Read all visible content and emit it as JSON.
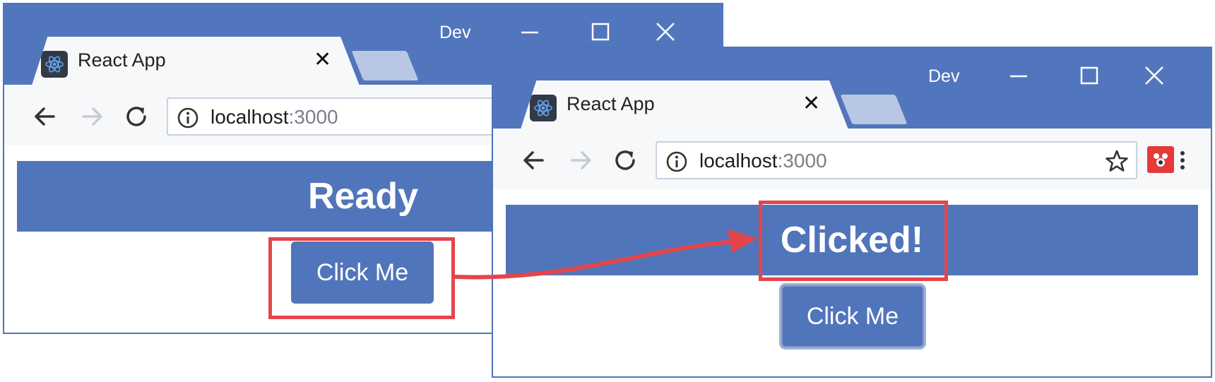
{
  "colors": {
    "chrome_blue": "#5276bd",
    "banner_blue": "#5175bb",
    "highlight_red": "#e3454b"
  },
  "window_before": {
    "profile": "Dev",
    "tab": {
      "title": "React App"
    },
    "url": {
      "host": "localhost",
      "port": ":3000"
    },
    "heading": "Ready",
    "button_label": "Click Me"
  },
  "window_after": {
    "profile": "Dev",
    "tab": {
      "title": "React App"
    },
    "url": {
      "host": "localhost",
      "port": ":3000"
    },
    "heading": "Clicked!",
    "button_label": "Click Me"
  },
  "icons": [
    "back-arrow-icon",
    "forward-arrow-icon",
    "reload-icon",
    "info-icon",
    "star-icon",
    "extension-icon",
    "menu-icon",
    "minimize-icon",
    "maximize-icon",
    "close-icon",
    "react-favicon-icon"
  ]
}
